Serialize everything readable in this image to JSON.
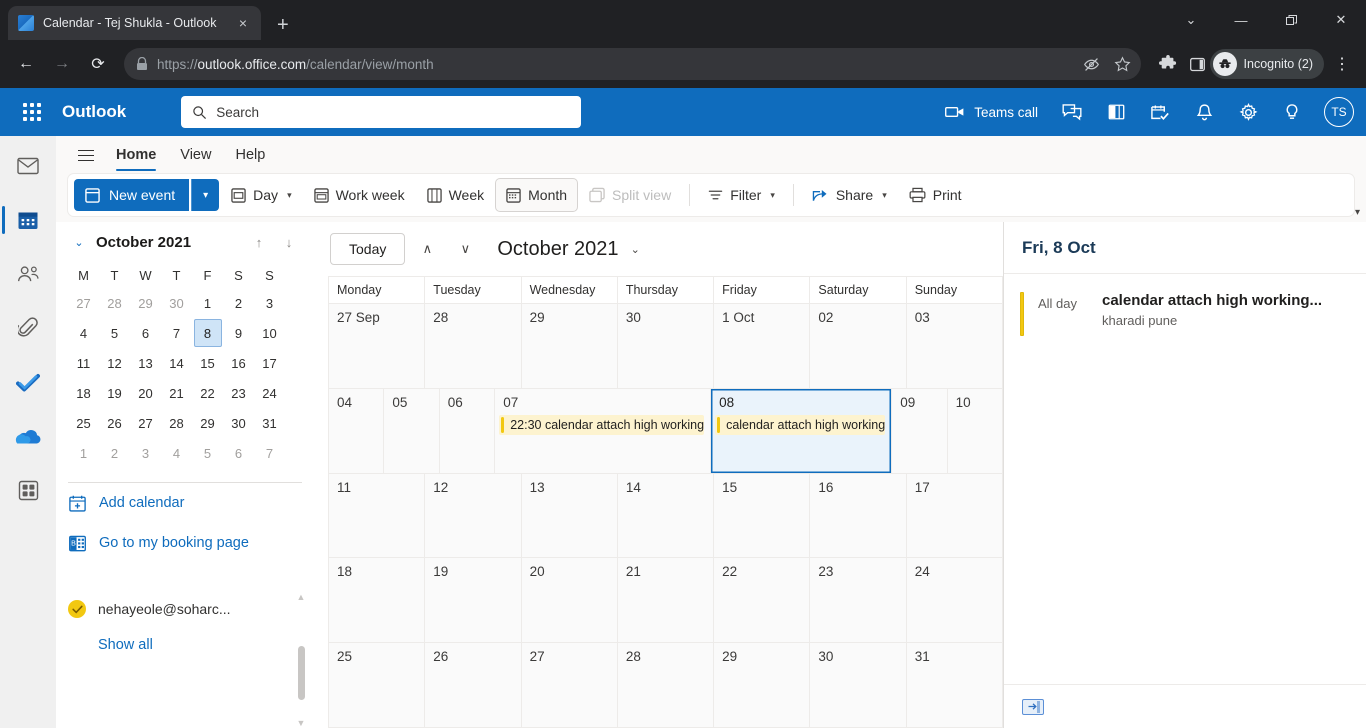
{
  "browser": {
    "tab_title": "Calendar - Tej Shukla - Outlook",
    "tab_close": "×",
    "new_tab": "+",
    "window_controls": {
      "minimize_list": "⌄",
      "minimize": "—",
      "maximize": "❐",
      "close": "✕"
    },
    "back": "←",
    "forward": "→",
    "reload": "⟳",
    "lock_icon": "🔒",
    "url_scheme": "https://",
    "url_domain": "outlook.office.com",
    "url_path": "/calendar/view/month",
    "profile_label": "Incognito (2)",
    "kebab": "⋮"
  },
  "outlook_top": {
    "brand": "Outlook",
    "search_placeholder": "Search",
    "teams_call": "Teams call",
    "avatar_initials": "TS",
    "icons": [
      "chat-icon",
      "note-icon",
      "tasks-icon",
      "bell-icon",
      "gear-icon",
      "tip-icon"
    ]
  },
  "ribbon": {
    "tabs": [
      {
        "label": "Home",
        "selected": true
      },
      {
        "label": "View",
        "selected": false
      },
      {
        "label": "Help",
        "selected": false
      }
    ],
    "toolbar": {
      "new_event": "New event",
      "day": "Day",
      "work_week": "Work week",
      "week": "Week",
      "month": "Month",
      "split_view": "Split view",
      "filter": "Filter",
      "share": "Share",
      "print": "Print"
    }
  },
  "rail": {
    "items": [
      {
        "name": "mail",
        "icon": "envelope-icon",
        "active": false
      },
      {
        "name": "calendar",
        "icon": "calendar-icon",
        "active": true
      },
      {
        "name": "people",
        "icon": "people-icon",
        "active": false
      },
      {
        "name": "files",
        "icon": "paperclip-icon",
        "active": false
      },
      {
        "name": "todo",
        "icon": "checkmark-icon",
        "active": false
      },
      {
        "name": "onedrive",
        "icon": "cloud-icon",
        "active": false
      },
      {
        "name": "apps",
        "icon": "apps-grid-icon",
        "active": false
      }
    ]
  },
  "mini_calendar": {
    "title": "October 2021",
    "collapse_chevron": "⌄",
    "prev": "↑",
    "next": "↓",
    "day_initials": [
      "M",
      "T",
      "W",
      "T",
      "F",
      "S",
      "S"
    ],
    "weeks": [
      [
        {
          "d": "27",
          "mute": true
        },
        {
          "d": "28",
          "mute": true
        },
        {
          "d": "29",
          "mute": true
        },
        {
          "d": "30",
          "mute": true
        },
        {
          "d": "1",
          "mute": false
        },
        {
          "d": "2",
          "mute": false
        },
        {
          "d": "3",
          "mute": false
        }
      ],
      [
        {
          "d": "4",
          "mute": false
        },
        {
          "d": "5",
          "mute": false
        },
        {
          "d": "6",
          "mute": false
        },
        {
          "d": "7",
          "mute": false
        },
        {
          "d": "8",
          "mute": false,
          "selected": true
        },
        {
          "d": "9",
          "mute": false
        },
        {
          "d": "10",
          "mute": false
        }
      ],
      [
        {
          "d": "11",
          "mute": false
        },
        {
          "d": "12",
          "mute": false
        },
        {
          "d": "13",
          "mute": false
        },
        {
          "d": "14",
          "mute": false
        },
        {
          "d": "15",
          "mute": false
        },
        {
          "d": "16",
          "mute": false
        },
        {
          "d": "17",
          "mute": false
        }
      ],
      [
        {
          "d": "18",
          "mute": false
        },
        {
          "d": "19",
          "mute": false
        },
        {
          "d": "20",
          "mute": false
        },
        {
          "d": "21",
          "mute": false
        },
        {
          "d": "22",
          "mute": false
        },
        {
          "d": "23",
          "mute": false
        },
        {
          "d": "24",
          "mute": false
        }
      ],
      [
        {
          "d": "25",
          "mute": false
        },
        {
          "d": "26",
          "mute": false
        },
        {
          "d": "27",
          "mute": false
        },
        {
          "d": "28",
          "mute": false
        },
        {
          "d": "29",
          "mute": false
        },
        {
          "d": "30",
          "mute": false
        },
        {
          "d": "31",
          "mute": false
        }
      ],
      [
        {
          "d": "1",
          "mute": true
        },
        {
          "d": "2",
          "mute": true
        },
        {
          "d": "3",
          "mute": true
        },
        {
          "d": "4",
          "mute": true
        },
        {
          "d": "5",
          "mute": true
        },
        {
          "d": "6",
          "mute": true
        },
        {
          "d": "7",
          "mute": true
        }
      ]
    ]
  },
  "sidebar_links": {
    "add_calendar": "Add calendar",
    "booking_page": "Go to my booking page",
    "account": "nehayeole@soharc...",
    "show_all": "Show all"
  },
  "calendar": {
    "today_button": "Today",
    "prev_arrow": "∧",
    "next_arrow": "∨",
    "month_title": "October 2021",
    "month_caret": "⌄",
    "day_headers": [
      "Monday",
      "Tuesday",
      "Wednesday",
      "Thursday",
      "Friday",
      "Saturday",
      "Sunday"
    ],
    "weeks": [
      {
        "days": [
          {
            "num": "27 Sep",
            "events": []
          },
          {
            "num": "28",
            "events": []
          },
          {
            "num": "29",
            "events": []
          },
          {
            "num": "30",
            "events": []
          },
          {
            "num": "1 Oct",
            "events": []
          },
          {
            "num": "02",
            "events": []
          },
          {
            "num": "03",
            "events": []
          }
        ]
      },
      {
        "days": [
          {
            "num": "04",
            "events": []
          },
          {
            "num": "05",
            "events": []
          },
          {
            "num": "06",
            "events": []
          },
          {
            "num": "07",
            "events": [
              {
                "label": "22:30 calendar attach high working",
                "color": "#f2c811"
              }
            ]
          },
          {
            "num": "08",
            "selected": true,
            "events": [
              {
                "label": "calendar attach high working",
                "color": "#f2c811"
              }
            ]
          },
          {
            "num": "09",
            "events": []
          },
          {
            "num": "10",
            "events": []
          }
        ]
      },
      {
        "days": [
          {
            "num": "11",
            "events": []
          },
          {
            "num": "12",
            "events": []
          },
          {
            "num": "13",
            "events": []
          },
          {
            "num": "14",
            "events": []
          },
          {
            "num": "15",
            "events": []
          },
          {
            "num": "16",
            "events": []
          },
          {
            "num": "17",
            "events": []
          }
        ]
      },
      {
        "days": [
          {
            "num": "18",
            "events": []
          },
          {
            "num": "19",
            "events": []
          },
          {
            "num": "20",
            "events": []
          },
          {
            "num": "21",
            "events": []
          },
          {
            "num": "22",
            "events": []
          },
          {
            "num": "23",
            "events": []
          },
          {
            "num": "24",
            "events": []
          }
        ]
      },
      {
        "days": [
          {
            "num": "25",
            "events": []
          },
          {
            "num": "26",
            "events": []
          },
          {
            "num": "27",
            "events": []
          },
          {
            "num": "28",
            "events": []
          },
          {
            "num": "29",
            "events": []
          },
          {
            "num": "30",
            "events": []
          },
          {
            "num": "31",
            "events": []
          }
        ]
      }
    ]
  },
  "agenda": {
    "header": "Fri, 8 Oct",
    "items": [
      {
        "when": "All day",
        "title": "calendar attach high working...",
        "location": "kharadi pune",
        "color": "#f2c811"
      }
    ]
  },
  "colors": {
    "outlook_blue": "#0f6cbd",
    "event_yellow": "#f2c811",
    "event_fill": "#fdf3cf",
    "selected_day_fill": "#eaf3fb"
  }
}
